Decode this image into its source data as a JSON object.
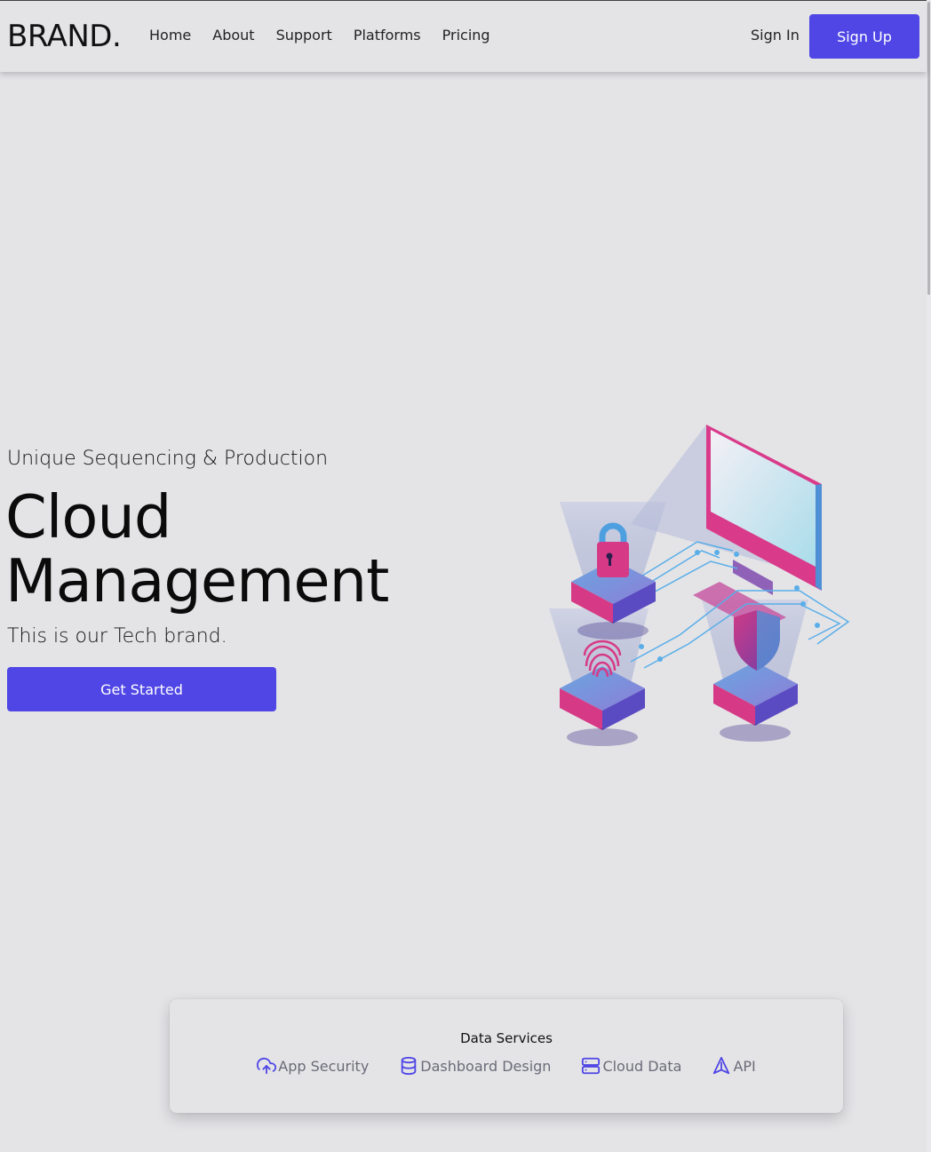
{
  "nav": {
    "brand": "BRAND.",
    "links": [
      "Home",
      "About",
      "Support",
      "Platforms",
      "Pricing"
    ],
    "signin": "Sign In",
    "signup": "Sign Up"
  },
  "hero": {
    "eyebrow": "Unique Sequencing & Production",
    "title_line1": "Cloud",
    "title_line2": "Management",
    "subtitle": "This is our Tech brand.",
    "cta": "Get Started",
    "illustration_icon": "cloud-security-isometric-illustration"
  },
  "services": {
    "title": "Data Services",
    "items": [
      {
        "label": "App Security",
        "icon": "cloud-upload-icon"
      },
      {
        "label": "Dashboard Design",
        "icon": "database-icon"
      },
      {
        "label": "Cloud Data",
        "icon": "server-icon"
      },
      {
        "label": "API",
        "icon": "navigation-triangle-icon"
      }
    ]
  },
  "colors": {
    "background": "#e4e4e7",
    "accent": "#4f46e5",
    "muted_text": "#6b6b78",
    "illustration_pink": "#d63a86",
    "illustration_blue": "#4d9fe0"
  }
}
